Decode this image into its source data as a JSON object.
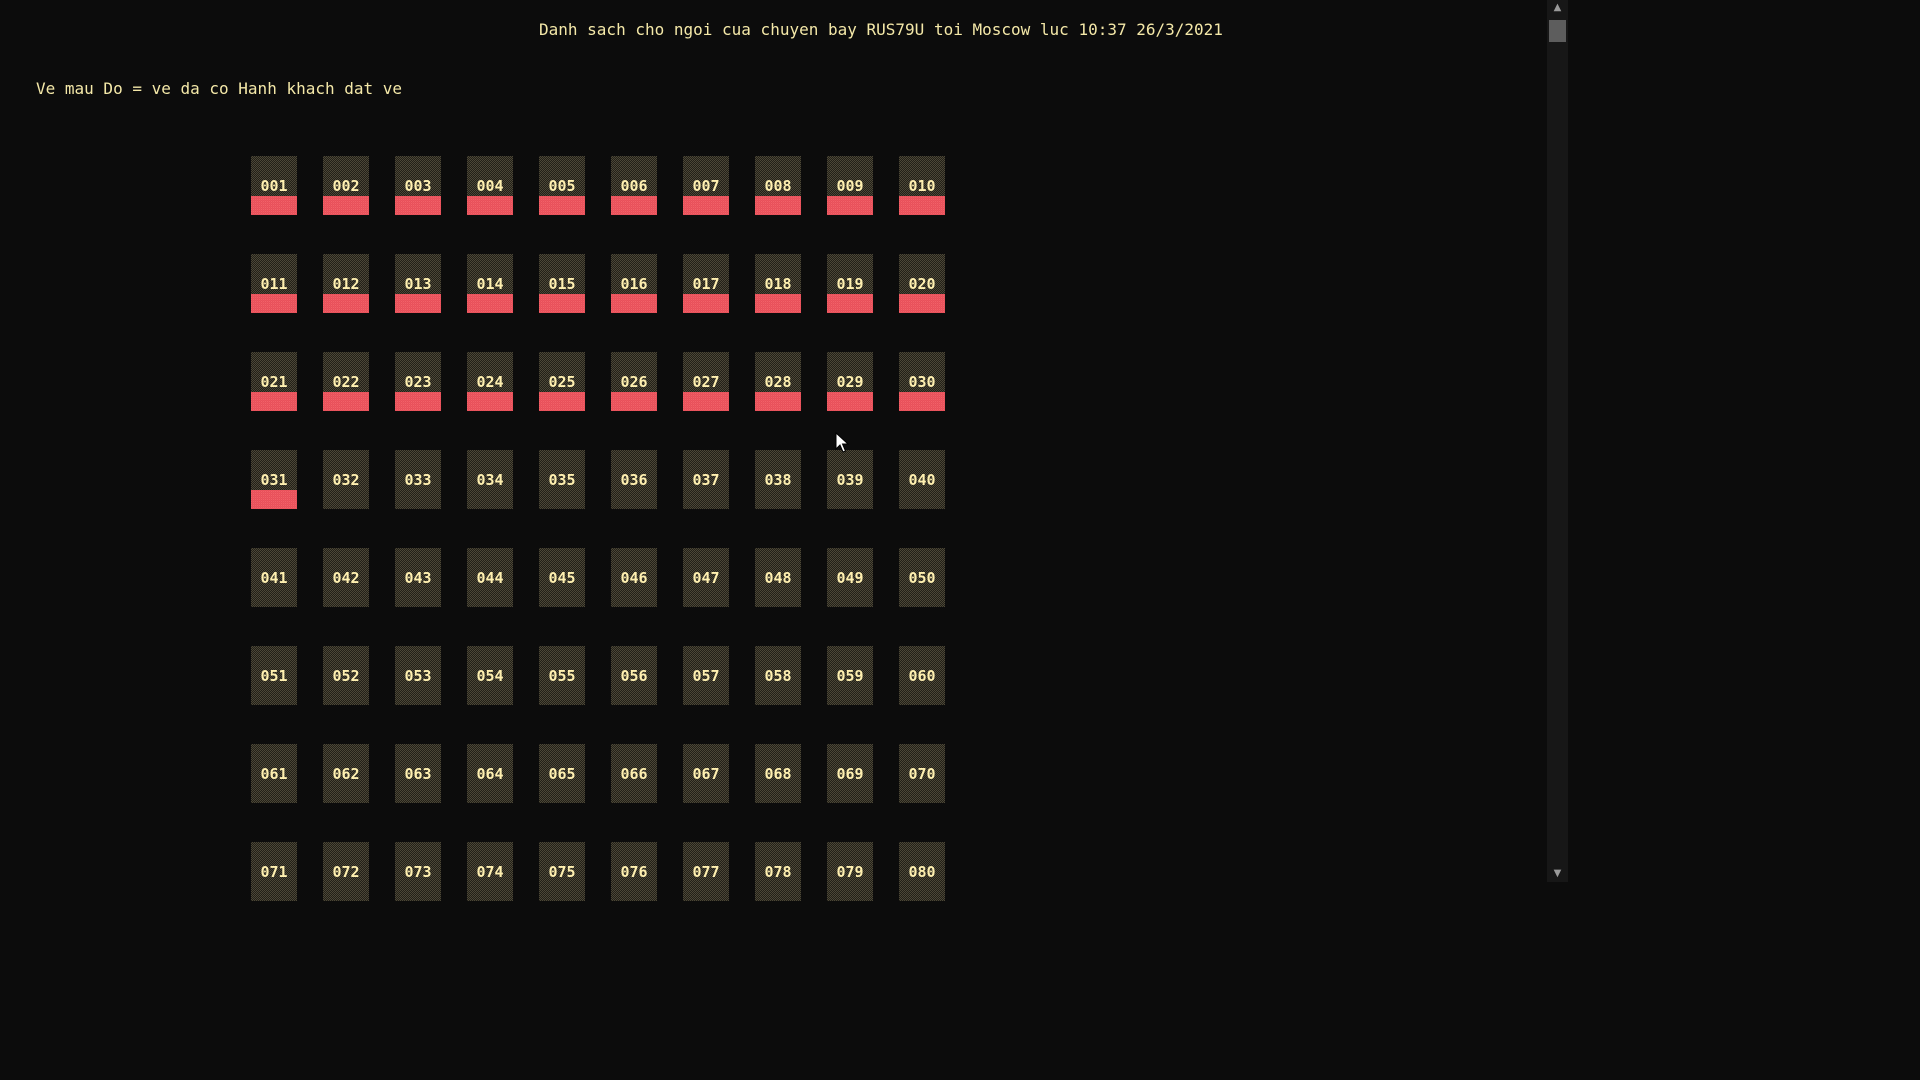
{
  "header": {
    "title": "Danh sach cho ngoi cua chuyen bay RUS79U toi Moscow luc 10:37 26/3/2021",
    "legend": "Ve mau Do = ve da co Hanh khach dat ve"
  },
  "colors": {
    "background": "#0c0c0c",
    "text": "#f4e8a8",
    "booked_bar": "#e8505a"
  },
  "seats": [
    {
      "label": "001",
      "booked": true
    },
    {
      "label": "002",
      "booked": true
    },
    {
      "label": "003",
      "booked": true
    },
    {
      "label": "004",
      "booked": true
    },
    {
      "label": "005",
      "booked": true
    },
    {
      "label": "006",
      "booked": true
    },
    {
      "label": "007",
      "booked": true
    },
    {
      "label": "008",
      "booked": true
    },
    {
      "label": "009",
      "booked": true
    },
    {
      "label": "010",
      "booked": true
    },
    {
      "label": "011",
      "booked": true
    },
    {
      "label": "012",
      "booked": true
    },
    {
      "label": "013",
      "booked": true
    },
    {
      "label": "014",
      "booked": true
    },
    {
      "label": "015",
      "booked": true
    },
    {
      "label": "016",
      "booked": true
    },
    {
      "label": "017",
      "booked": true
    },
    {
      "label": "018",
      "booked": true
    },
    {
      "label": "019",
      "booked": true
    },
    {
      "label": "020",
      "booked": true
    },
    {
      "label": "021",
      "booked": true
    },
    {
      "label": "022",
      "booked": true
    },
    {
      "label": "023",
      "booked": true
    },
    {
      "label": "024",
      "booked": true
    },
    {
      "label": "025",
      "booked": true
    },
    {
      "label": "026",
      "booked": true
    },
    {
      "label": "027",
      "booked": true
    },
    {
      "label": "028",
      "booked": true
    },
    {
      "label": "029",
      "booked": true
    },
    {
      "label": "030",
      "booked": true
    },
    {
      "label": "031",
      "booked": true
    },
    {
      "label": "032",
      "booked": false
    },
    {
      "label": "033",
      "booked": false
    },
    {
      "label": "034",
      "booked": false
    },
    {
      "label": "035",
      "booked": false
    },
    {
      "label": "036",
      "booked": false
    },
    {
      "label": "037",
      "booked": false
    },
    {
      "label": "038",
      "booked": false
    },
    {
      "label": "039",
      "booked": false
    },
    {
      "label": "040",
      "booked": false
    },
    {
      "label": "041",
      "booked": false
    },
    {
      "label": "042",
      "booked": false
    },
    {
      "label": "043",
      "booked": false
    },
    {
      "label": "044",
      "booked": false
    },
    {
      "label": "045",
      "booked": false
    },
    {
      "label": "046",
      "booked": false
    },
    {
      "label": "047",
      "booked": false
    },
    {
      "label": "048",
      "booked": false
    },
    {
      "label": "049",
      "booked": false
    },
    {
      "label": "050",
      "booked": false
    },
    {
      "label": "051",
      "booked": false
    },
    {
      "label": "052",
      "booked": false
    },
    {
      "label": "053",
      "booked": false
    },
    {
      "label": "054",
      "booked": false
    },
    {
      "label": "055",
      "booked": false
    },
    {
      "label": "056",
      "booked": false
    },
    {
      "label": "057",
      "booked": false
    },
    {
      "label": "058",
      "booked": false
    },
    {
      "label": "059",
      "booked": false
    },
    {
      "label": "060",
      "booked": false
    },
    {
      "label": "061",
      "booked": false
    },
    {
      "label": "062",
      "booked": false
    },
    {
      "label": "063",
      "booked": false
    },
    {
      "label": "064",
      "booked": false
    },
    {
      "label": "065",
      "booked": false
    },
    {
      "label": "066",
      "booked": false
    },
    {
      "label": "067",
      "booked": false
    },
    {
      "label": "068",
      "booked": false
    },
    {
      "label": "069",
      "booked": false
    },
    {
      "label": "070",
      "booked": false
    },
    {
      "label": "071",
      "booked": false
    },
    {
      "label": "072",
      "booked": false
    },
    {
      "label": "073",
      "booked": false
    },
    {
      "label": "074",
      "booked": false
    },
    {
      "label": "075",
      "booked": false
    },
    {
      "label": "076",
      "booked": false
    },
    {
      "label": "077",
      "booked": false
    },
    {
      "label": "078",
      "booked": false
    },
    {
      "label": "079",
      "booked": false
    },
    {
      "label": "080",
      "booked": false
    }
  ],
  "icons": {
    "scroll_up": "scroll-up-arrow-icon",
    "scroll_down": "scroll-down-arrow-icon",
    "cursor": "mouse-pointer-icon"
  }
}
